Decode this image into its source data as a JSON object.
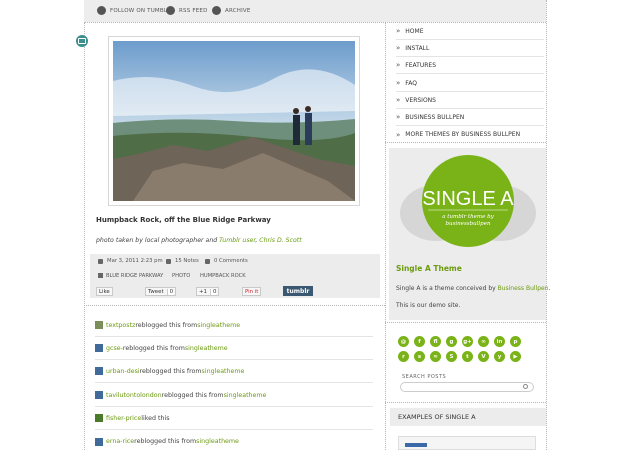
{
  "topbar": {
    "links": [
      {
        "label": "FOLLOW ON TUMBLR",
        "icon": "tumblr-icon"
      },
      {
        "label": "RSS FEED",
        "icon": "rss-icon"
      },
      {
        "label": "ARCHIVE",
        "icon": "archive-icon"
      }
    ]
  },
  "post": {
    "title": "Humpback Rock, off the Blue Ridge Parkway",
    "caption_prefix": "photo taken by local photographer and ",
    "caption_link1": "Tumblr user",
    "caption_sep": ", ",
    "caption_link2": "Chris D. Scott",
    "date": "Mar 3, 2011 2:23 pm",
    "notes": "15 Notes",
    "comments": "0 Comments",
    "tags": [
      "BLUE RIDGE PARKWAY",
      "PHOTO",
      "HUMPBACK ROCK"
    ],
    "share": {
      "like": "Like",
      "tweet": "Tweet",
      "tweet_count": "0",
      "plus": "+1",
      "plus_count": "0",
      "pin": "Pin it",
      "tumblr": "tumblr"
    }
  },
  "notes_list": [
    {
      "user": "textpostz",
      "action": " reblogged this from ",
      "source": "singleatheme"
    },
    {
      "user": "gcse-",
      "action": " reblogged this from ",
      "source": "singleatheme"
    },
    {
      "user": "urban-desi",
      "action": " reblogged this from ",
      "source": "singleatheme"
    },
    {
      "user": "tavilutontolondon",
      "action": " reblogged this from ",
      "source": "singleatheme"
    },
    {
      "user": "fisher-price",
      "action": " liked this",
      "source": ""
    },
    {
      "user": "erna-rice",
      "action": " reblogged this from ",
      "source": "singleatheme"
    }
  ],
  "sidebar": {
    "nav": [
      "HOME",
      "INSTALL",
      "FEATURES",
      "FAQ",
      "VERSIONS",
      "BUSINESS BULLPEN",
      "MORE THEMES BY BUSINESS BULLPEN"
    ],
    "logo_title": "SINGLE A",
    "logo_sub1": "a tumblr theme by",
    "logo_sub2": "businessbullpen",
    "promo_title": "Single A Theme",
    "promo_text_prefix": "Single A is a theme conceived by ",
    "promo_link": "Business Bullpen",
    "promo_text_suffix": ".",
    "promo_text2": "This is our demo site.",
    "social_row1": [
      "@",
      "f",
      "fl",
      "g",
      "g+",
      "∞",
      "in",
      "p"
    ],
    "social_row2": [
      "r",
      "s",
      "≈",
      "S",
      "t",
      "V",
      "y",
      "▶"
    ],
    "search_label": "SEARCH POSTS",
    "search_placeholder": "",
    "examples_heading": "EXAMPLES OF SINGLE A"
  },
  "colors": {
    "accent": "#7ab317",
    "link": "#6c9a10",
    "panel": "#ececec",
    "tumblr": "#3b5873"
  }
}
